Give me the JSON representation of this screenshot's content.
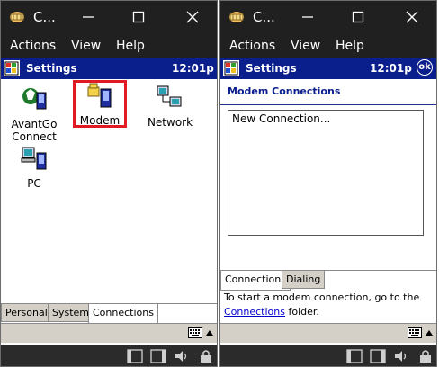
{
  "left_window": {
    "title": "C...",
    "menu": [
      "Actions",
      "View",
      "Help"
    ],
    "app_bar": {
      "title": "Settings",
      "clock": "12:01p"
    },
    "icons": [
      {
        "label_line1": "AvantGo",
        "label_line2": "Connect",
        "icon": "avantgo-connect-icon"
      },
      {
        "label_line1": "Modem",
        "label_line2": "",
        "icon": "modem-icon",
        "selected": true
      },
      {
        "label_line1": "Network",
        "label_line2": "",
        "icon": "network-icon"
      },
      {
        "label_line1": "PC",
        "label_line2": "",
        "icon": "pc-icon"
      }
    ],
    "tabs": [
      "Personal",
      "System",
      "Connections"
    ],
    "active_tab": "Connections"
  },
  "right_window": {
    "title": "C...",
    "menu": [
      "Actions",
      "View",
      "Help"
    ],
    "app_bar": {
      "title": "Settings",
      "clock": "12:01p",
      "ok_label": "ok"
    },
    "section_title": "Modem Connections",
    "connections_list": [
      "New Connection..."
    ],
    "tabs": [
      "Connections",
      "Dialing"
    ],
    "active_tab": "Connections",
    "info_text_1": "To start a modem connection, go to the",
    "info_link": "Connections",
    "info_text_2": " folder."
  },
  "colors": {
    "title_bar": "#202020",
    "pocketpc_bar": "#0a1e8c",
    "selection_outline": "#e01b24",
    "link": "#0000cc"
  }
}
